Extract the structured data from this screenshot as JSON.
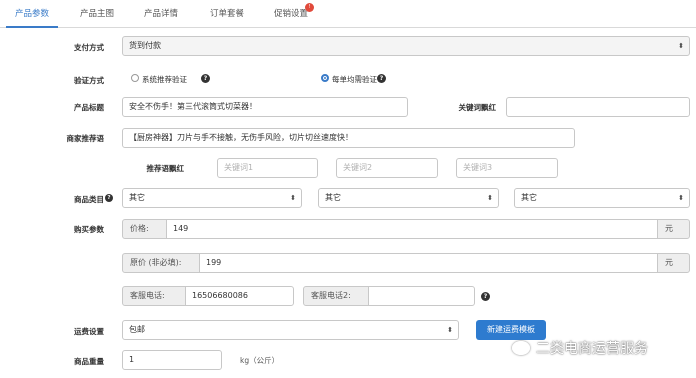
{
  "tabs": [
    "产品参数",
    "产品主图",
    "产品详情",
    "订单套餐",
    "促销设置"
  ],
  "tab_badge": "!",
  "payment": {
    "label": "支付方式",
    "value": "货到付款"
  },
  "verify": {
    "label": "验证方式",
    "option1": "系统推荐验证",
    "option2": "每单均需验证",
    "selected": 2
  },
  "title": {
    "label": "产品标题",
    "value": "安全不伤手！第三代滚筒式切菜器！",
    "keyword_label": "关键词飘红"
  },
  "recommend": {
    "label": "商家推荐语",
    "value": "【厨房神器】刀片与手不接触，无伤手风险，切片切丝速度快！"
  },
  "rec_keywords": {
    "label": "推荐语飘红",
    "placeholders": [
      "关键词1",
      "关键词2",
      "关键词3"
    ]
  },
  "category": {
    "label": "商品类目",
    "values": [
      "其它",
      "其它",
      "其它"
    ]
  },
  "purchase": {
    "label": "购买参数",
    "price_label": "价格:",
    "price_value": "149",
    "currency": "元",
    "orig_label": "原价 (非必填):",
    "orig_value": "199",
    "phone1_label": "客服电话:",
    "phone1_value": "16506680086",
    "phone2_label": "客服电话2:",
    "phone2_value": ""
  },
  "shipping": {
    "label": "运费设置",
    "value": "包邮",
    "button": "新建运费模板"
  },
  "weight": {
    "label": "商品重量",
    "value": "1",
    "unit": "kg（公斤）"
  },
  "watermark": "二类电商运营服务"
}
